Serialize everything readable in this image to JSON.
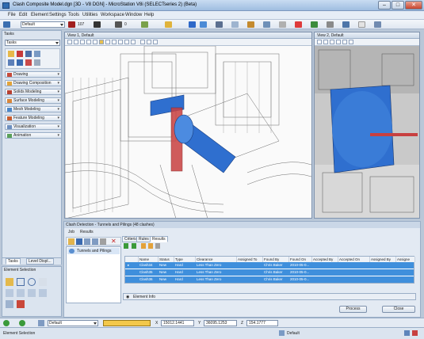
{
  "window": {
    "title": "Clash Composite Model.dgn [3D - V8 DGN] - MicroStation V8i (SELECTseries 2) (Beta)"
  },
  "menu": [
    "File",
    "Edit",
    "Element",
    "Settings",
    "Tools",
    "Utilities",
    "Workspace",
    "Window",
    "Help"
  ],
  "toolbar": {
    "level": "Default",
    "color_num": "107",
    "weight": "0"
  },
  "tasks": {
    "title": "Tasks",
    "selected": "Tasks",
    "items": [
      "Drawing",
      "Drawing Composition",
      "Solids Modeling",
      "Surface Modeling",
      "Mesh Modeling",
      "Feature Modeling",
      "Visualization",
      "Animation"
    ]
  },
  "lefttabs": {
    "tasks": "Tasks",
    "level": "Level Displ..."
  },
  "element_selection": {
    "title": "Element Selection"
  },
  "views": {
    "view1": "View 1, Default",
    "view2": "View 2, Default"
  },
  "clash": {
    "title": "Clash Detection - Tunnels and Pilings (48 clashes)",
    "menu": [
      "Job",
      "Results"
    ],
    "job_name": "Tunnels and Pilings",
    "tabs": [
      "Criteria",
      "Rules",
      "Results"
    ],
    "columns": [
      "Name",
      "Status",
      "Type",
      "Clearance",
      "Assigned To",
      "Found By",
      "Found On",
      "Accepted By",
      "Accepted On",
      "Assigned By",
      "Assigne"
    ],
    "rows": [
      [
        "Clash34",
        "New",
        "Hard",
        "Less Than Zero",
        "",
        "Chris Baker",
        "2010-05-0..."
      ],
      [
        "Clash35",
        "New",
        "Hard",
        "Less Than Zero",
        "",
        "Chris Baker",
        "2010-05-0..."
      ],
      [
        "Clash36",
        "New",
        "Hard",
        "Less Than Zero",
        "",
        "Chris Baker",
        "2010-05-0..."
      ]
    ],
    "element_info": "Element Info",
    "process": "Process",
    "close": "Close"
  },
  "status": {
    "level": "Default",
    "x_label": "X",
    "x": "15012.1441",
    "y_label": "Y",
    "y": "36095.1253",
    "z_label": "Z",
    "z": "154.1777",
    "message": "Element Selection",
    "status_level": "Default"
  },
  "colors": {
    "accent": "#3f8fdc",
    "clash_blue": "#2f6fcf",
    "clash_red": "#c84040"
  }
}
